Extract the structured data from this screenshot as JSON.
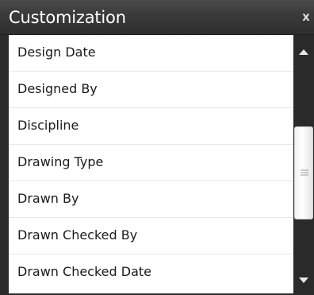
{
  "window": {
    "title": "Customization",
    "close_label": "x"
  },
  "list": {
    "items": [
      {
        "label": "Design Date"
      },
      {
        "label": "Designed By"
      },
      {
        "label": "Discipline"
      },
      {
        "label": "Drawing Type"
      },
      {
        "label": "Drawn By"
      },
      {
        "label": "Drawn Checked By"
      },
      {
        "label": "Drawn Checked Date"
      }
    ]
  },
  "scrollbar": {
    "up_icon": "triangle-up-icon",
    "down_icon": "triangle-down-icon",
    "grip_icon": "grip-lines-icon",
    "position": 0.45
  },
  "colors": {
    "titlebar": "#3a3a3a",
    "title_text": "#ffffff",
    "list_background": "#ffffff",
    "scrollbar_track": "#2a2a2a"
  }
}
